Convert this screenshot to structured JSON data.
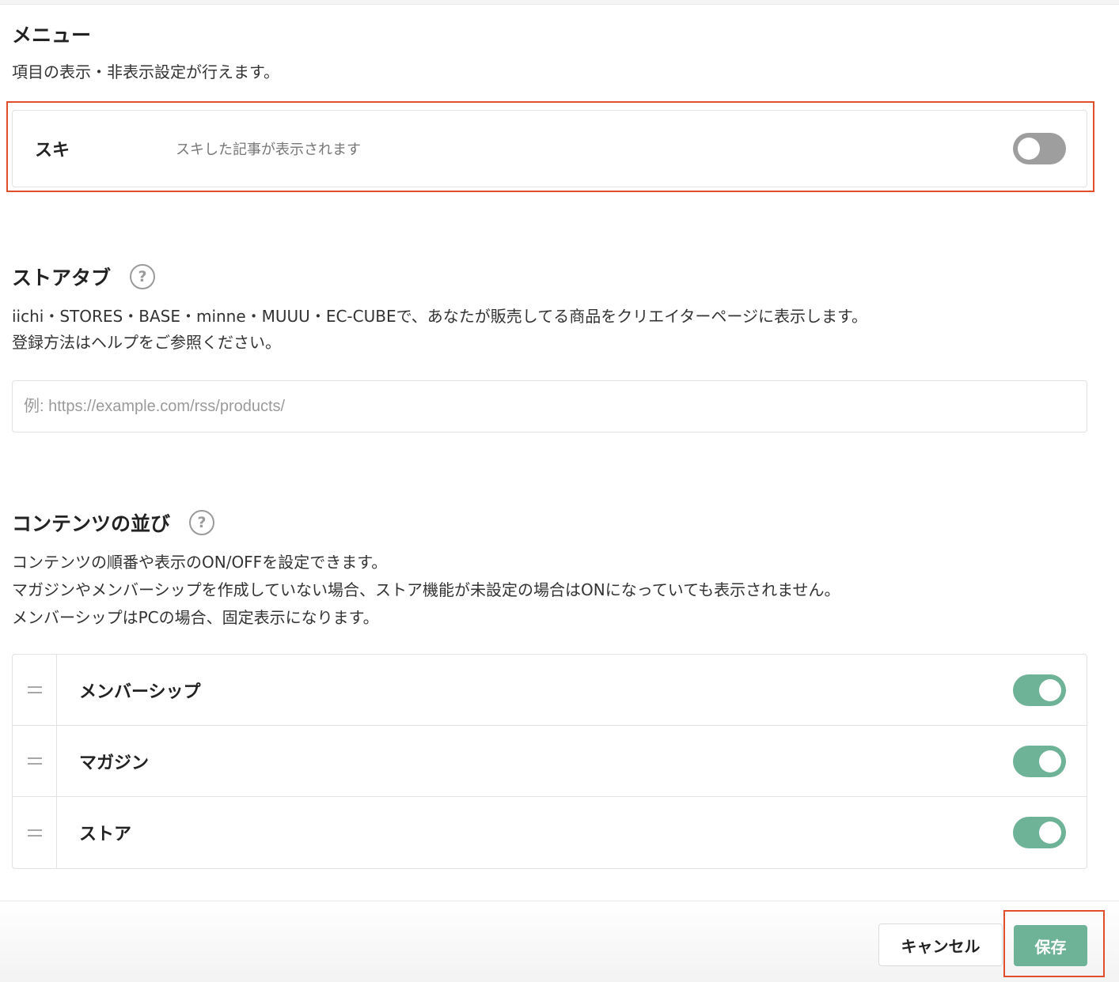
{
  "menu": {
    "title": "メニュー",
    "description": "項目の表示・非表示設定が行えます。",
    "suki": {
      "label": "スキ",
      "description": "スキした記事が表示されます",
      "enabled": false
    }
  },
  "store_tab": {
    "title": "ストアタブ",
    "help_glyph": "?",
    "description_line1": "iichi・STORES・BASE・minne・MUUU・EC-CUBEで、あなたが販売してる商品をクリエイターページに表示します。",
    "description_line2": "登録方法はヘルプをご参照ください。",
    "url_placeholder": "例: https://example.com/rss/products/",
    "url_value": ""
  },
  "content_order": {
    "title": "コンテンツの並び",
    "help_glyph": "?",
    "description_lines": [
      "コンテンツの順番や表示のON/OFFを設定できます。",
      "マガジンやメンバーシップを作成していない場合、ストア機能が未設定の場合はONになっていても表示されません。",
      "メンバーシップはPCの場合、固定表示になります。"
    ],
    "items": [
      {
        "label": "メンバーシップ",
        "enabled": true
      },
      {
        "label": "マガジン",
        "enabled": true
      },
      {
        "label": "ストア",
        "enabled": true
      }
    ]
  },
  "footer": {
    "cancel_label": "キャンセル",
    "save_label": "保存"
  },
  "colors": {
    "accent": "#6eb298",
    "toggle_off": "#9e9e9e",
    "highlight": "#e04e2c"
  }
}
